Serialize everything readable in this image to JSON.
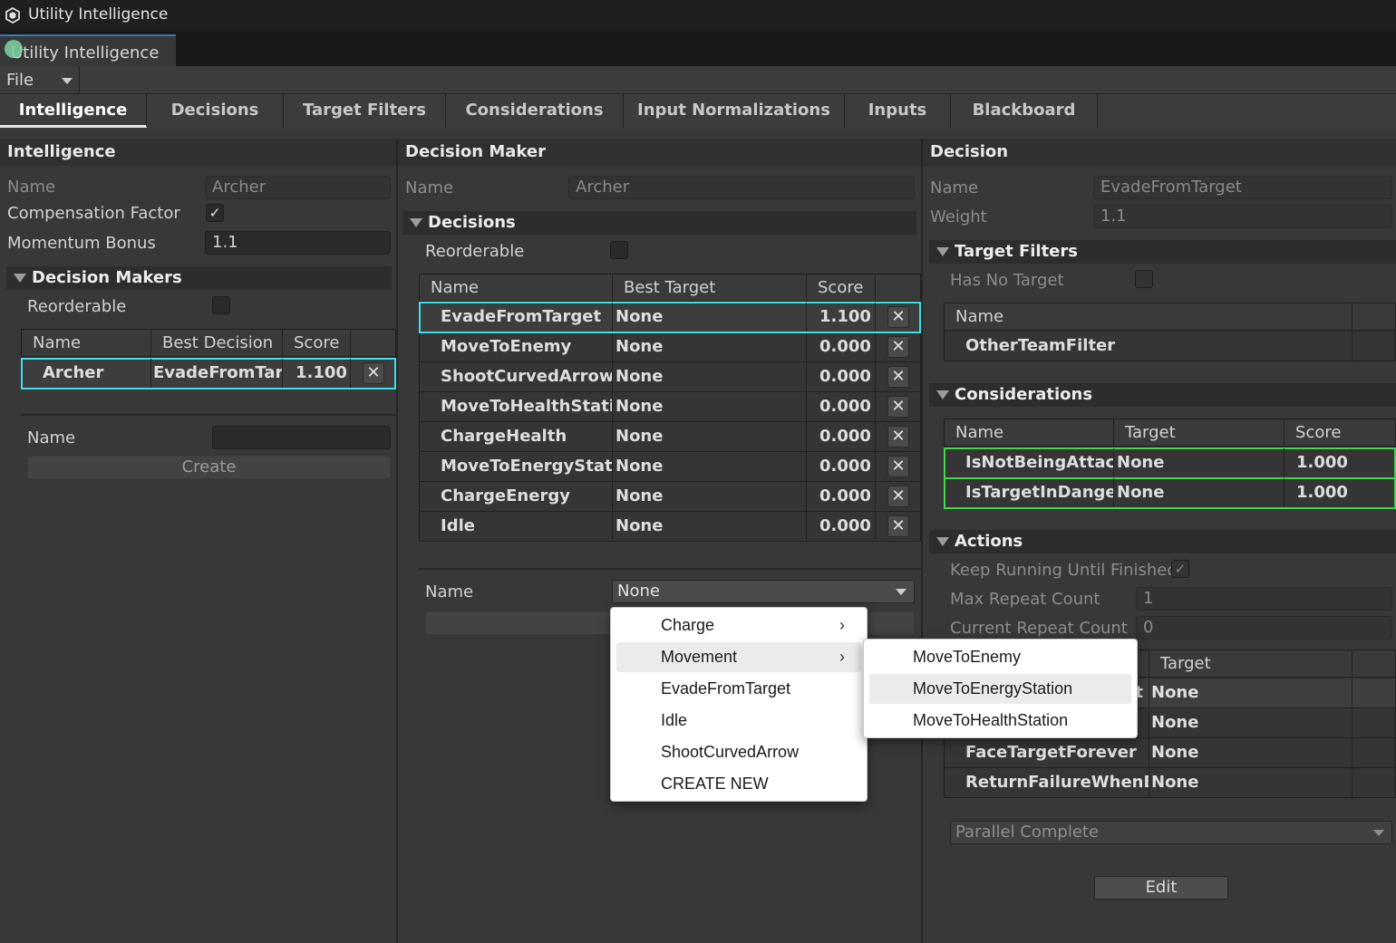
{
  "window": {
    "title": "Utility Intelligence",
    "tab_label": "Utility Intelligence"
  },
  "menubar": {
    "file": "File"
  },
  "tabs": [
    "Intelligence",
    "Decisions",
    "Target Filters",
    "Considerations",
    "Input Normalizations",
    "Inputs",
    "Blackboard"
  ],
  "intelligence": {
    "header": "Intelligence",
    "name_label": "Name",
    "name_value": "Archer",
    "comp_label": "Compensation Factor",
    "momentum_label": "Momentum Bonus",
    "momentum_value": "1.1",
    "dm_section": "Decision Makers",
    "reorderable": "Reorderable",
    "columns": [
      "Name",
      "Best Decision",
      "Score"
    ],
    "rows": [
      {
        "name": "Archer",
        "best": "EvadeFromTarge",
        "score": "1.100"
      }
    ],
    "new_name_label": "Name",
    "create_label": "Create"
  },
  "decision_maker": {
    "header": "Decision Maker",
    "name_label": "Name",
    "name_value": "Archer",
    "section": "Decisions",
    "reorderable": "Reorderable",
    "columns": [
      "Name",
      "Best Target",
      "Score"
    ],
    "rows": [
      {
        "name": "EvadeFromTarget",
        "target": "None",
        "score": "1.100"
      },
      {
        "name": "MoveToEnemy",
        "target": "None",
        "score": "0.000"
      },
      {
        "name": "ShootCurvedArrow",
        "target": "None",
        "score": "0.000"
      },
      {
        "name": "MoveToHealthStation",
        "target": "None",
        "score": "0.000"
      },
      {
        "name": "ChargeHealth",
        "target": "None",
        "score": "0.000"
      },
      {
        "name": "MoveToEnergyStation",
        "target": "None",
        "score": "0.000"
      },
      {
        "name": "ChargeEnergy",
        "target": "None",
        "score": "0.000"
      },
      {
        "name": "Idle",
        "target": "None",
        "score": "0.000"
      }
    ],
    "new_name_label": "Name",
    "dropdown_value": "None"
  },
  "decision": {
    "header": "Decision",
    "name_label": "Name",
    "name_value": "EvadeFromTarget",
    "weight_label": "Weight",
    "weight_value": "1.1",
    "tf_section": "Target Filters",
    "has_no_target": "Has No Target",
    "tf_columns": [
      "Name"
    ],
    "tf_rows": [
      "OtherTeamFilter"
    ],
    "cons_section": "Considerations",
    "cons_columns": [
      "Name",
      "Target",
      "Score"
    ],
    "cons_rows": [
      {
        "name": "IsNotBeingAttacke",
        "target": "None",
        "score": "1.000"
      },
      {
        "name": "IsTargetInDangerR",
        "target": "None",
        "score": "1.000"
      }
    ],
    "actions_section": "Actions",
    "keep_running": "Keep Running Until Finished",
    "max_repeat_label": "Max Repeat Count",
    "max_repeat_value": "1",
    "current_repeat_label": "Current Repeat Count",
    "current_repeat_value": "0",
    "act_columns": [
      "",
      "Target"
    ],
    "act_rows": [
      {
        "name": "t",
        "target": "None"
      },
      {
        "name": "",
        "target": "None"
      },
      {
        "name": "FaceTargetForever",
        "target": "None"
      },
      {
        "name": "ReturnFailureWhenBeir",
        "target": "None"
      }
    ],
    "mode_value": "Parallel Complete",
    "edit_label": "Edit"
  },
  "popup_menu": {
    "items": [
      "Charge",
      "Movement",
      "EvadeFromTarget",
      "Idle",
      "ShootCurvedArrow",
      "CREATE NEW"
    ],
    "submenu_chevron": "›"
  },
  "submenu": {
    "items": [
      "MoveToEnemy",
      "MoveToEnergyStation",
      "MoveToHealthStation"
    ]
  },
  "icons": {
    "check": "✓",
    "close": "✕"
  }
}
